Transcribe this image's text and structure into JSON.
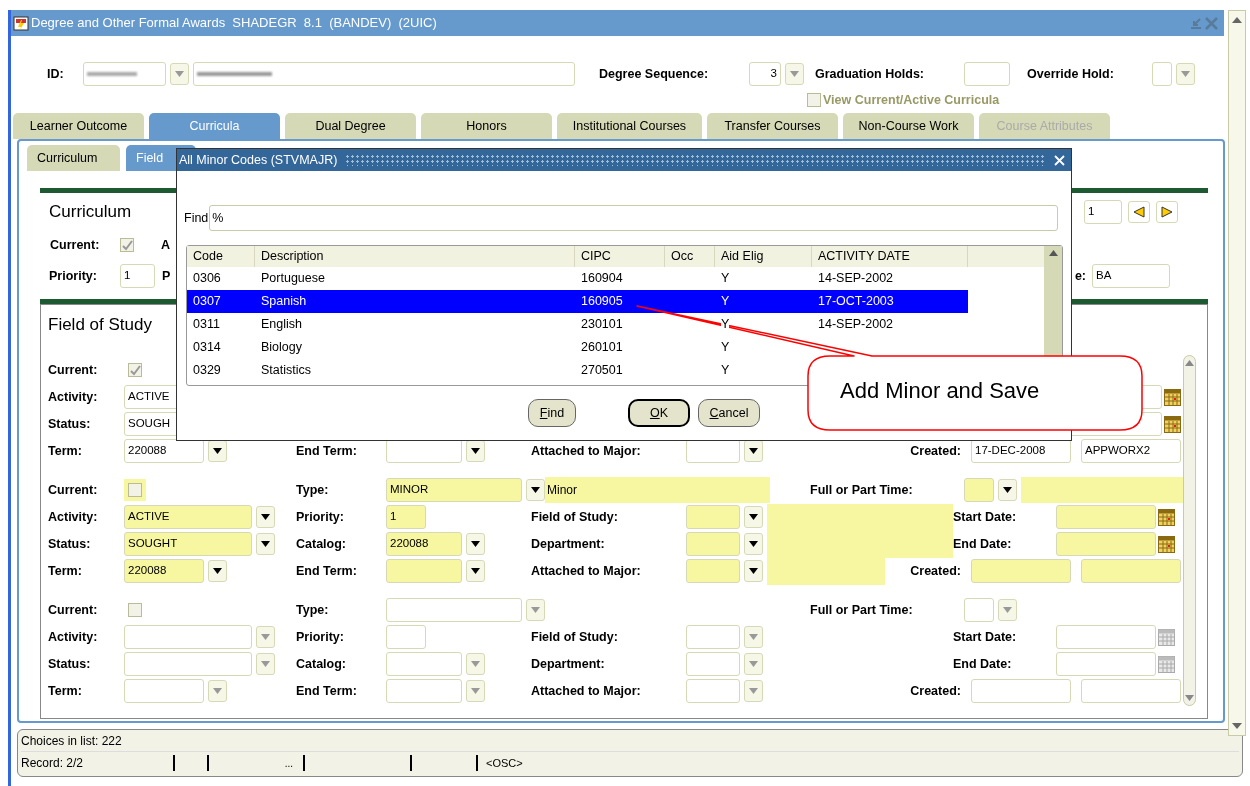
{
  "window": {
    "title": "Degree and Other Formal Awards  SHADEGR  8.1  (BANDEV)  (2UIC)"
  },
  "header": {
    "id_label": "ID:",
    "degree_sequence_label": "Degree Sequence:",
    "degree_sequence": "3",
    "graduation_holds_label": "Graduation Holds:",
    "override_hold_label": "Override Hold:",
    "view_current": {
      "label": "View Current/Active Curricula",
      "checked": false
    }
  },
  "tabs": [
    {
      "label": "Learner Outcome",
      "selected": false,
      "disabled": false
    },
    {
      "label": "Curricula",
      "selected": true,
      "disabled": false
    },
    {
      "label": "Dual Degree",
      "selected": false,
      "disabled": false
    },
    {
      "label": "Honors",
      "selected": false,
      "disabled": false
    },
    {
      "label": "Institutional Courses",
      "selected": false,
      "disabled": false
    },
    {
      "label": "Transfer Courses",
      "selected": false,
      "disabled": false
    },
    {
      "label": "Non-Course Work",
      "selected": false,
      "disabled": false
    },
    {
      "label": "Course Attributes",
      "selected": false,
      "disabled": true
    }
  ],
  "subtabs": [
    {
      "label": "Curriculum",
      "selected": false
    },
    {
      "label": "Field",
      "selected": true
    }
  ],
  "curriculum": {
    "title": "Curriculum",
    "current_label": "Current:",
    "current_checked": true,
    "fragment_1": "A",
    "priority_label": "Priority:",
    "priority": "1",
    "fragment_2": "P",
    "record_number": "1",
    "label_fragment": "e:",
    "degree": "BA"
  },
  "field_of_study": {
    "title": "Field of Study",
    "records": [
      {
        "kind": "partial",
        "selected": false,
        "enabled": true,
        "current": true,
        "labels": {
          "current": "Current:",
          "activity": "Activity:",
          "status": "Status:",
          "term": "Term:",
          "end_term": "End Term:",
          "attached_to_major": "Attached to Major:",
          "created": "Created:"
        },
        "values": {
          "activity": "ACTIVE",
          "status": "SOUGH",
          "term": "220088",
          "created": "17-DEC-2008",
          "created_by": "APPWORX2"
        }
      },
      {
        "kind": "full",
        "selected": true,
        "enabled": true,
        "current": false,
        "labels": {
          "current": "Current:",
          "activity": "Activity:",
          "status": "Status:",
          "term": "Term:",
          "type": "Type:",
          "priority": "Priority:",
          "catalog": "Catalog:",
          "end_term": "End Term:",
          "field_of_study": "Field of Study:",
          "department": "Department:",
          "attached_to_major": "Attached to Major:",
          "full_or_part_time": "Full or Part Time:",
          "start_date": "Start Date:",
          "end_date": "End Date:",
          "created": "Created:"
        },
        "values": {
          "type": "MINOR",
          "type_desc": "Minor",
          "activity": "ACTIVE",
          "priority": "1",
          "status": "SOUGHT",
          "catalog": "220088",
          "term": "220088"
        }
      },
      {
        "kind": "full",
        "selected": false,
        "enabled": false,
        "current": false,
        "labels": {
          "current": "Current:",
          "activity": "Activity:",
          "status": "Status:",
          "term": "Term:",
          "type": "Type:",
          "priority": "Priority:",
          "catalog": "Catalog:",
          "end_term": "End Term:",
          "field_of_study": "Field of Study:",
          "department": "Department:",
          "attached_to_major": "Attached to Major:",
          "full_or_part_time": "Full or Part Time:",
          "start_date": "Start Date:",
          "end_date": "End Date:",
          "created": "Created:"
        }
      }
    ]
  },
  "status_bar": {
    "message": "Choices in list: 222",
    "record": "Record: 2/2",
    "ellipsis": "...",
    "mode": "<OSC>"
  },
  "dialog": {
    "title": "All Minor Codes (STVMAJR)",
    "find_label": "Find",
    "find_value": "%",
    "columns": [
      "Code",
      "Description",
      "CIPC",
      "Occ",
      "Aid Elig",
      "ACTIVITY DATE"
    ],
    "rows": [
      {
        "code": "0306",
        "description": "Portuguese",
        "cipc": "160904",
        "aid_elig": "Y",
        "activity_date": "14-SEP-2002",
        "selected": false
      },
      {
        "code": "0307",
        "description": "Spanish",
        "cipc": "160905",
        "aid_elig": "Y",
        "activity_date": "17-OCT-2003",
        "selected": true
      },
      {
        "code": "0311",
        "description": "English",
        "cipc": "230101",
        "aid_elig": "Y",
        "activity_date": "14-SEP-2002",
        "selected": false
      },
      {
        "code": "0314",
        "description": "Biology",
        "cipc": "260101",
        "aid_elig": "Y",
        "selected": false
      },
      {
        "code": "0329",
        "description": "Statistics",
        "cipc": "270501",
        "aid_elig": "Y",
        "selected": false
      }
    ],
    "buttons": [
      "Find",
      "OK",
      "Cancel"
    ]
  },
  "callout": {
    "text": "Add Minor and Save"
  }
}
